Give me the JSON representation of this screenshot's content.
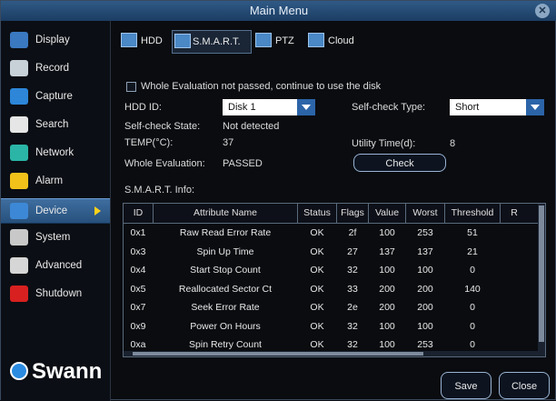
{
  "window": {
    "title": "Main Menu"
  },
  "sidebar": {
    "items": [
      {
        "label": "Display",
        "icon": "display-icon",
        "color": "#3a78c0"
      },
      {
        "label": "Record",
        "icon": "record-icon",
        "color": "#c8d0d8"
      },
      {
        "label": "Capture",
        "icon": "capture-icon",
        "color": "#2d86d8"
      },
      {
        "label": "Search",
        "icon": "search-icon",
        "color": "#e6e6e6"
      },
      {
        "label": "Network",
        "icon": "network-icon",
        "color": "#2bb5a6"
      },
      {
        "label": "Alarm",
        "icon": "alarm-icon",
        "color": "#f2c21a"
      },
      {
        "label": "Device",
        "icon": "device-icon",
        "color": "#3d88d6",
        "active": true
      },
      {
        "label": "System",
        "icon": "system-icon",
        "color": "#c8c8c8"
      },
      {
        "label": "Advanced",
        "icon": "advanced-icon",
        "color": "#d6d6d6"
      },
      {
        "label": "Shutdown",
        "icon": "shutdown-icon",
        "color": "#d82020"
      }
    ],
    "logo_text": "Swann"
  },
  "tabs": [
    {
      "label": "HDD"
    },
    {
      "label": "S.M.A.R.T.",
      "active": true
    },
    {
      "label": "PTZ"
    },
    {
      "label": "Cloud"
    }
  ],
  "smart": {
    "whole_eval_checkbox_label": "Whole Evaluation not passed, continue to use the disk",
    "hdd_id_label": "HDD ID:",
    "hdd_id_value": "Disk 1",
    "selfcheck_type_label": "Self-check Type:",
    "selfcheck_type_value": "Short",
    "selfcheck_state_label": "Self-check State:",
    "selfcheck_state_value": "Not detected",
    "temp_label": "TEMP(°C):",
    "temp_value": "37",
    "utility_time_label": "Utility Time(d):",
    "utility_time_value": "8",
    "whole_eval_label": "Whole Evaluation:",
    "whole_eval_value": "PASSED",
    "check_button": "Check",
    "info_label": "S.M.A.R.T. Info:"
  },
  "table": {
    "headers": [
      "ID",
      "Attribute Name",
      "Status",
      "Flags",
      "Value",
      "Worst",
      "Threshold",
      "R"
    ],
    "rows": [
      [
        "0x1",
        "Raw Read Error Rate",
        "OK",
        "2f",
        "100",
        "253",
        "51"
      ],
      [
        "0x3",
        "Spin Up Time",
        "OK",
        "27",
        "137",
        "137",
        "21"
      ],
      [
        "0x4",
        "Start Stop Count",
        "OK",
        "32",
        "100",
        "100",
        "0"
      ],
      [
        "0x5",
        "Reallocated Sector Ct",
        "OK",
        "33",
        "200",
        "200",
        "140"
      ],
      [
        "0x7",
        "Seek Error Rate",
        "OK",
        "2e",
        "200",
        "200",
        "0"
      ],
      [
        "0x9",
        "Power On Hours",
        "OK",
        "32",
        "100",
        "100",
        "0"
      ],
      [
        "0xa",
        "Spin Retry Count",
        "OK",
        "32",
        "100",
        "253",
        "0"
      ]
    ]
  },
  "footer": {
    "save": "Save",
    "close": "Close"
  }
}
